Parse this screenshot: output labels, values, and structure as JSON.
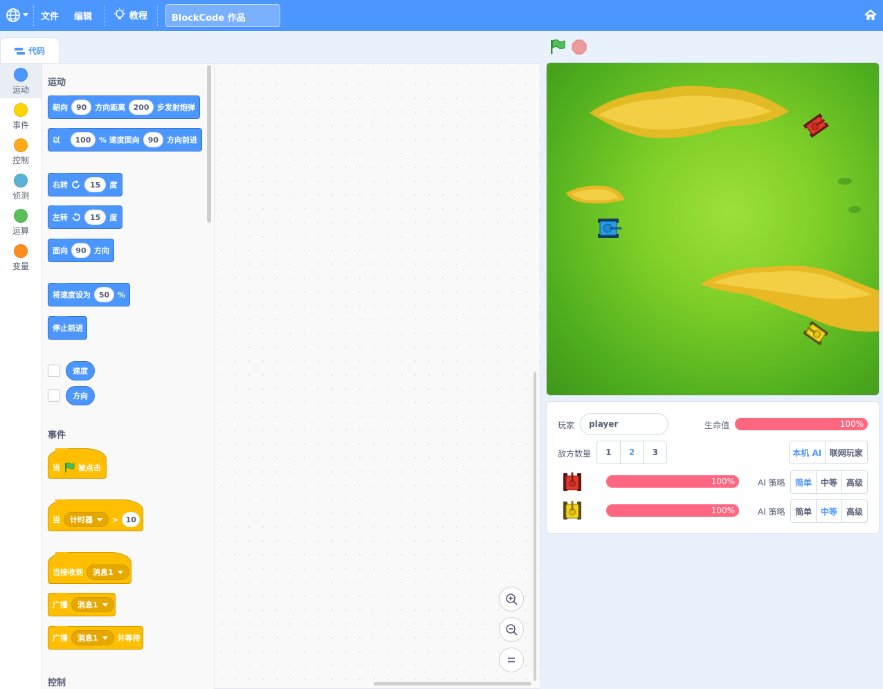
{
  "menu": {
    "file": "文件",
    "edit": "编辑",
    "tutorial": "教程",
    "project_title": "BlockCode 作品"
  },
  "tabs": {
    "code": "代码"
  },
  "categories": [
    {
      "label": "运动",
      "color": "#4c97ff"
    },
    {
      "label": "事件",
      "color": "#ffd500"
    },
    {
      "label": "控制",
      "color": "#ffab19"
    },
    {
      "label": "侦测",
      "color": "#5cb1d6"
    },
    {
      "label": "运算",
      "color": "#59c059"
    },
    {
      "label": "变量",
      "color": "#ff8c1a"
    }
  ],
  "palette": {
    "motion_title": "运动",
    "fire": {
      "a": "朝向",
      "dir": "90",
      "b": "方向距离",
      "dist": "200",
      "c": "步发射炮弹"
    },
    "move": {
      "a": "以",
      "speed": "100",
      "b": "% 速度面向",
      "dir": "90",
      "c": "方向前进"
    },
    "turn_right": {
      "a": "右转",
      "deg": "15",
      "b": "度"
    },
    "turn_left": {
      "a": "左转",
      "deg": "15",
      "b": "度"
    },
    "point": {
      "a": "面向",
      "dir": "90",
      "b": "方向"
    },
    "set_speed": {
      "a": "将速度设为",
      "val": "50",
      "b": "%"
    },
    "stop": "停止前进",
    "reporter_speed": "速度",
    "reporter_dir": "方向",
    "events_title": "事件",
    "when_flag": {
      "a": "当",
      "b": "被点击"
    },
    "when_gt": {
      "a": "当",
      "dropdown": "计时器",
      "op": ">",
      "val": "10"
    },
    "when_receive": {
      "a": "当接收到",
      "dropdown": "消息1"
    },
    "broadcast": {
      "a": "广播",
      "dropdown": "消息1"
    },
    "broadcast_wait": {
      "a": "广播",
      "dropdown": "消息1",
      "b": "并等待"
    },
    "control_title": "控制"
  },
  "panel": {
    "player_label": "玩家",
    "player_name": "player",
    "hp_label": "生命值",
    "hp_value": "100%",
    "hp_fraction": 1.0,
    "enemy_count_label": "敌方数量",
    "enemy_count_options": [
      "1",
      "2",
      "3"
    ],
    "enemy_count_selected": "2",
    "mode_options": [
      "本机 AI",
      "联网玩家"
    ],
    "mode_selected": "本机 AI",
    "enemies": [
      {
        "hp": "100%",
        "hp_fraction": 1.0,
        "strategy_label": "AI 策略",
        "strategy_options": [
          "简单",
          "中等",
          "高级"
        ],
        "strategy_selected": "简单",
        "tank_color": "#e0382c"
      },
      {
        "hp": "100%",
        "hp_fraction": 1.0,
        "strategy_label": "AI 策略",
        "strategy_options": [
          "简单",
          "中等",
          "高级"
        ],
        "strategy_selected": "中等",
        "tank_color": "#f2d21c"
      }
    ]
  },
  "icons": {
    "globe": "globe-icon",
    "tutorial": "lightbulb-icon",
    "home": "home-icon",
    "code_tab": "code-icon",
    "flag": "green-flag-icon",
    "stop": "stop-icon",
    "zoom_in": "zoom-in-icon",
    "zoom_out": "zoom-out-icon",
    "zoom_reset": "zoom-reset-icon"
  }
}
